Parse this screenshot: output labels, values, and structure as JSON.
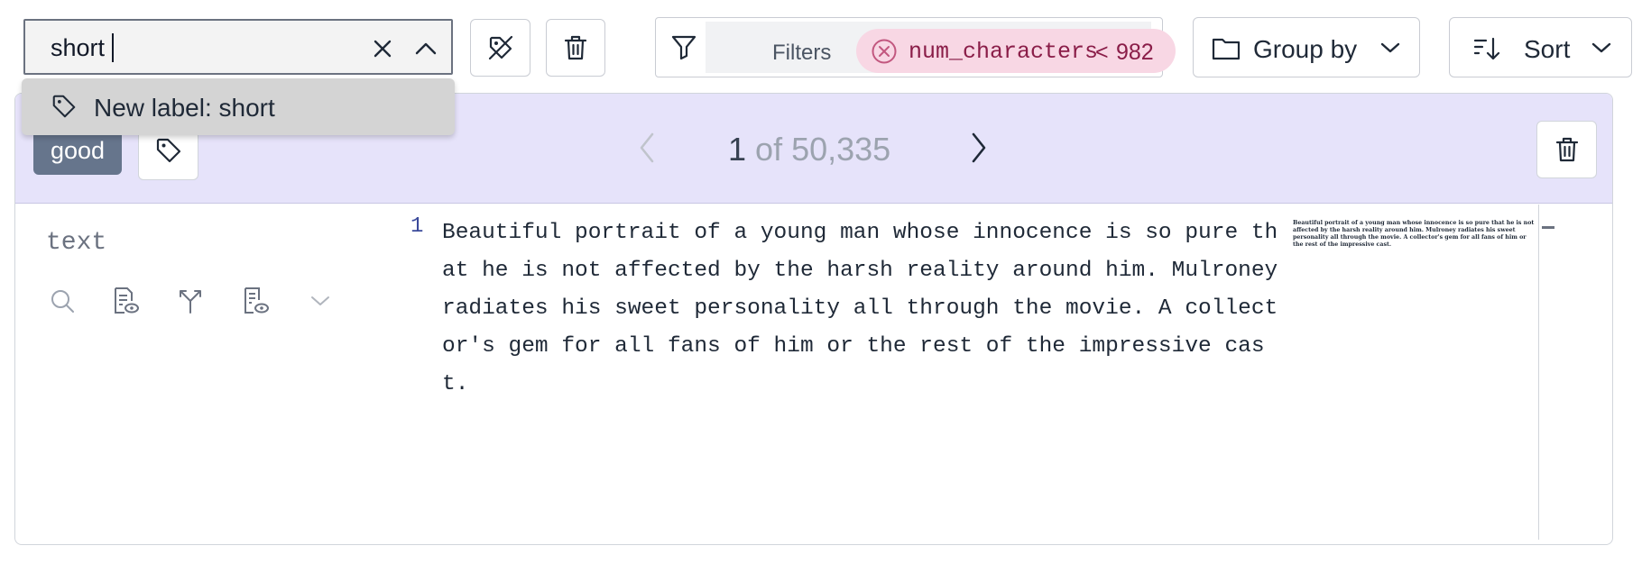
{
  "toolbar": {
    "label_search": {
      "value": "short",
      "clear_icon": "close-icon",
      "collapse_icon": "chevron-up-icon"
    },
    "remove_labels_icon": "tag-off-icon",
    "delete_icon": "trash-icon",
    "filters": {
      "label": "Filters",
      "icon": "filter-icon",
      "chips": [
        {
          "field": "num_characters",
          "operator": "<",
          "value": "982",
          "remove_icon": "circle-x-icon"
        }
      ]
    },
    "group_by": {
      "label": "Group by",
      "icon": "folder-icon",
      "chevron": "chevron-down-icon"
    },
    "sort": {
      "label": "Sort",
      "icon": "sort-icon",
      "chevron": "chevron-down-icon"
    }
  },
  "dropdown": {
    "items": [
      {
        "label": "New label: short",
        "icon": "tag-icon"
      }
    ]
  },
  "record": {
    "labels": [
      "good"
    ],
    "add_label_icon": "tag-icon",
    "pager": {
      "current": "1",
      "of": "of",
      "total": "50,335"
    },
    "field": {
      "name": "text",
      "tools": [
        "search-icon",
        "document-preview-icon",
        "merge-icon",
        "data-preview-icon",
        "chevron-down-icon"
      ]
    },
    "content": {
      "line_number": "1",
      "text": "Beautiful portrait of a young man whose innocence is so pure that he is not affected by the harsh reality around him. Mulroney radiates his sweet personality all through the movie. A collector's gem for all fans of him or the rest of the impressive cast."
    }
  },
  "colors": {
    "header_bg": "#e6e3fa",
    "chip_bg": "#f8d7e4",
    "chip_text": "#8a1d48",
    "tag_bg": "#66758c",
    "line_number": "#3b4a9b"
  }
}
